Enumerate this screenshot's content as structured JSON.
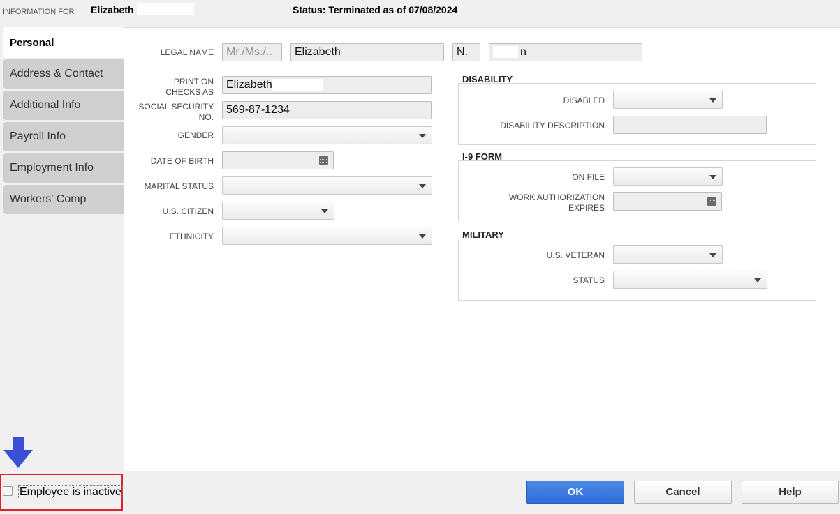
{
  "header": {
    "info_label": "INFORMATION FOR",
    "employee_name": "Elizabeth",
    "status": "Status: Terminated as of 07/08/2024"
  },
  "tabs": [
    {
      "label": "Personal",
      "active": true
    },
    {
      "label": "Address & Contact"
    },
    {
      "label": "Additional Info"
    },
    {
      "label": "Payroll Info"
    },
    {
      "label": "Employment Info"
    },
    {
      "label": "Workers' Comp"
    }
  ],
  "personal": {
    "legal_name_label": "LEGAL NAME",
    "title_placeholder": "Mr./Ms./..",
    "first_name": "Elizabeth",
    "middle_initial": "N.",
    "last_name": "n",
    "print_on_checks_label": "PRINT ON CHECKS AS",
    "print_on_checks": "Elizabeth",
    "ssn_label": "SOCIAL SECURITY NO.",
    "ssn": "569-87-1234",
    "gender_label": "GENDER",
    "dob_label": "DATE OF BIRTH",
    "marital_label": "MARITAL STATUS",
    "citizen_label": "U.S. CITIZEN",
    "ethnicity_label": "ETHNICITY"
  },
  "disability": {
    "title": "DISABILITY",
    "disabled_label": "DISABLED",
    "description_label": "DISABILITY DESCRIPTION"
  },
  "i9": {
    "title": "I-9 FORM",
    "on_file_label": "ON FILE",
    "work_auth_label": "WORK AUTHORIZATION EXPIRES"
  },
  "military": {
    "title": "MILITARY",
    "veteran_label": "U.S. VETERAN",
    "status_label": "STATUS"
  },
  "footer": {
    "inactive_label": "Employee is inactive",
    "ok": "OK",
    "cancel": "Cancel",
    "help": "Help"
  },
  "colors": {
    "annotation_arrow": "#3a4fd6",
    "annotation_box": "#e0202a"
  }
}
